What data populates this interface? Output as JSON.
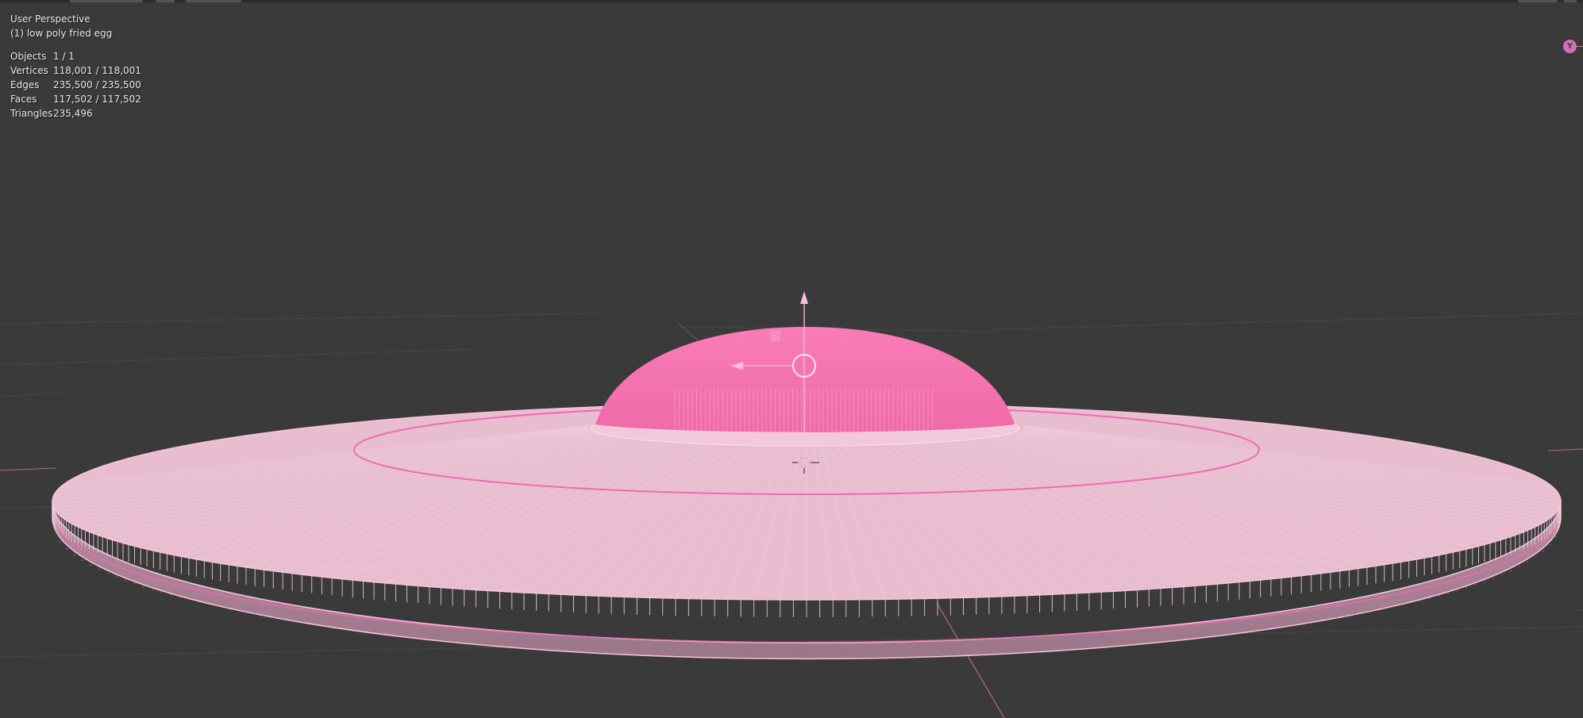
{
  "viewport": {
    "view_name": "User Perspective",
    "active_object": "(1) low poly fried egg"
  },
  "stats": [
    {
      "label": "Objects",
      "value": "1 / 1"
    },
    {
      "label": "Vertices",
      "value": "118,001 / 118,001"
    },
    {
      "label": "Edges",
      "value": "235,500 / 235,500"
    },
    {
      "label": "Faces",
      "value": "117,502 / 117,502"
    },
    {
      "label": "Triangles",
      "value": "235,496"
    }
  ],
  "navigation_gizmo": {
    "axis_label": "Y",
    "axis_color": "#d46fb4"
  },
  "colors": {
    "background": "#3a3a3a",
    "selection_wire": "#f7c6dd",
    "yolk": "#f678b4",
    "grid_line": "#4a4a4a"
  },
  "icons": {
    "object_origin": "origin-circle-icon",
    "cursor": "3d-cursor-icon",
    "transform_gizmo": "move-arrow-icon"
  }
}
